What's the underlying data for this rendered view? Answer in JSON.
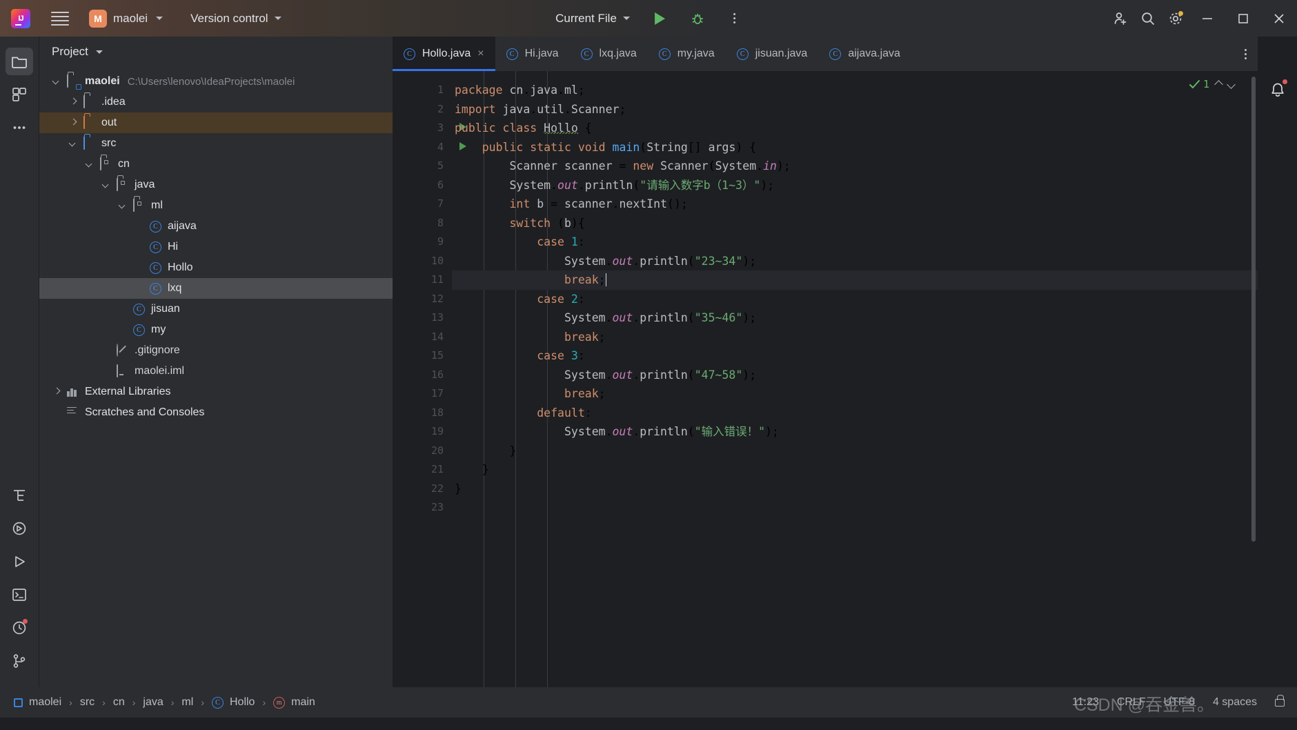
{
  "titlebar": {
    "project_name": "maolei",
    "version_control": "Version control",
    "run_config": "Current File",
    "icons": {
      "logo": "intellij-idea-logo",
      "menu": "hamburger-menu-icon",
      "run": "run-icon",
      "debug": "debug-bug-icon",
      "more": "more-vertical-icon",
      "share": "add-user-icon",
      "search": "search-icon",
      "settings": "gear-icon",
      "minimize": "minimize-icon",
      "maximize": "maximize-icon",
      "close": "close-icon"
    }
  },
  "rail": {
    "items": [
      {
        "name": "project-tool-window",
        "icon": "folder-icon",
        "active": true
      },
      {
        "name": "commit-tool-window",
        "icon": "commit-grid-icon",
        "active": false
      },
      {
        "name": "more-tool-windows",
        "icon": "more-horizontal-icon",
        "active": false
      },
      {
        "name": "structure-tool-window",
        "icon": "structure-icon",
        "active": false
      },
      {
        "name": "services-tool-window",
        "icon": "services-icon",
        "active": false
      },
      {
        "name": "run-tool-window",
        "icon": "run-triangle-icon",
        "active": false
      },
      {
        "name": "terminal-tool-window",
        "icon": "terminal-icon",
        "active": false
      },
      {
        "name": "problems-tool-window",
        "icon": "problems-clock-icon",
        "active": false
      },
      {
        "name": "version-control-tool-window",
        "icon": "branch-icon",
        "active": false
      }
    ]
  },
  "project_panel": {
    "title": "Project",
    "tree": [
      {
        "label": "maolei",
        "secondary": "C:\\Users\\lenovo\\IdeaProjects\\maolei",
        "indent": 0,
        "arrow": "down",
        "icon": "project-folder-icon",
        "state": "normal"
      },
      {
        "label": ".idea",
        "secondary": "",
        "indent": 1,
        "arrow": "right",
        "icon": "folder-icon",
        "state": "normal"
      },
      {
        "label": "out",
        "secondary": "",
        "indent": 1,
        "arrow": "right",
        "icon": "folder-orange-icon",
        "state": "highlight"
      },
      {
        "label": "src",
        "secondary": "",
        "indent": 1,
        "arrow": "down",
        "icon": "source-folder-icon",
        "state": "normal"
      },
      {
        "label": "cn",
        "secondary": "",
        "indent": 2,
        "arrow": "down",
        "icon": "package-icon",
        "state": "normal"
      },
      {
        "label": "java",
        "secondary": "",
        "indent": 3,
        "arrow": "down",
        "icon": "package-icon",
        "state": "normal"
      },
      {
        "label": "ml",
        "secondary": "",
        "indent": 4,
        "arrow": "down",
        "icon": "package-icon",
        "state": "normal"
      },
      {
        "label": "aijava",
        "secondary": "",
        "indent": 5,
        "arrow": "none",
        "icon": "java-class-icon",
        "state": "normal"
      },
      {
        "label": "Hi",
        "secondary": "",
        "indent": 5,
        "arrow": "none",
        "icon": "java-class-icon",
        "state": "normal"
      },
      {
        "label": "Hollo",
        "secondary": "",
        "indent": 5,
        "arrow": "none",
        "icon": "java-class-icon",
        "state": "normal"
      },
      {
        "label": "lxq",
        "secondary": "",
        "indent": 5,
        "arrow": "none",
        "icon": "java-class-icon",
        "state": "selected"
      },
      {
        "label": "jisuan",
        "secondary": "",
        "indent": 4,
        "arrow": "none",
        "icon": "java-class-icon",
        "state": "normal"
      },
      {
        "label": "my",
        "secondary": "",
        "indent": 4,
        "arrow": "none",
        "icon": "java-class-icon",
        "state": "normal"
      },
      {
        "label": ".gitignore",
        "secondary": "",
        "indent": 3,
        "arrow": "none",
        "icon": "gitignore-icon",
        "state": "normal"
      },
      {
        "label": "maolei.iml",
        "secondary": "",
        "indent": 3,
        "arrow": "none",
        "icon": "iml-file-icon",
        "state": "normal"
      },
      {
        "label": "External Libraries",
        "secondary": "",
        "indent": 0,
        "arrow": "right",
        "icon": "libraries-icon",
        "state": "normal"
      },
      {
        "label": "Scratches and Consoles",
        "secondary": "",
        "indent": 0,
        "arrow": "none",
        "icon": "scratches-icon",
        "state": "normal"
      }
    ]
  },
  "tabs": [
    {
      "label": "Hollo.java",
      "active": true,
      "closable": true
    },
    {
      "label": "Hi.java",
      "active": false,
      "closable": false
    },
    {
      "label": "lxq.java",
      "active": false,
      "closable": false
    },
    {
      "label": "my.java",
      "active": false,
      "closable": false
    },
    {
      "label": "jisuan.java",
      "active": false,
      "closable": false
    },
    {
      "label": "aijava.java",
      "active": false,
      "closable": false
    }
  ],
  "editor": {
    "inspection_count": "1",
    "file": "Hollo.java",
    "cursor_line": 11,
    "lines": [
      {
        "n": "1",
        "run": false,
        "text": "package cn.java.ml;"
      },
      {
        "n": "2",
        "run": false,
        "text": "import java.util.Scanner;"
      },
      {
        "n": "3",
        "run": true,
        "text": "public class Hollo {"
      },
      {
        "n": "4",
        "run": true,
        "text": "    public static void main(String[] args) {"
      },
      {
        "n": "5",
        "run": false,
        "text": "        Scanner scanner = new Scanner(System.in);"
      },
      {
        "n": "6",
        "run": false,
        "text": "        System.out.println(\"请输入数字b（1~3）\");"
      },
      {
        "n": "7",
        "run": false,
        "text": "        int b = scanner.nextInt();"
      },
      {
        "n": "8",
        "run": false,
        "text": "        switch (b){"
      },
      {
        "n": "9",
        "run": false,
        "text": "            case 1:"
      },
      {
        "n": "10",
        "run": false,
        "text": "                System.out.println(\"23~34\");"
      },
      {
        "n": "11",
        "run": false,
        "text": "                break;"
      },
      {
        "n": "12",
        "run": false,
        "text": "            case 2:"
      },
      {
        "n": "13",
        "run": false,
        "text": "                System.out.println(\"35~46\");"
      },
      {
        "n": "14",
        "run": false,
        "text": "                break;"
      },
      {
        "n": "15",
        "run": false,
        "text": "            case 3:"
      },
      {
        "n": "16",
        "run": false,
        "text": "                System.out.println(\"47~58\");"
      },
      {
        "n": "17",
        "run": false,
        "text": "                break;"
      },
      {
        "n": "18",
        "run": false,
        "text": "            default:"
      },
      {
        "n": "19",
        "run": false,
        "text": "                System.out.println(\"输入错误！\");"
      },
      {
        "n": "20",
        "run": false,
        "text": "        }"
      },
      {
        "n": "21",
        "run": false,
        "text": "    }"
      },
      {
        "n": "22",
        "run": false,
        "text": "}"
      },
      {
        "n": "23",
        "run": false,
        "text": ""
      }
    ]
  },
  "status": {
    "breadcrumb": [
      "maolei",
      "src",
      "cn",
      "java",
      "ml",
      "Hollo",
      "main"
    ],
    "separator": "›",
    "caret_position": "11:23",
    "line_separator": "CRLF",
    "encoding": "UTF-8",
    "indent": "4 spaces",
    "watermark": "CSDN @吞金兽。"
  },
  "colors": {
    "accent_blue": "#3574f0",
    "keyword": "#cf8e6d",
    "string": "#6aab73",
    "number": "#2aacb8",
    "static_field": "#c77dbb",
    "method": "#56a8f5",
    "bg_editor": "#1e1f22",
    "bg_panel": "#2b2d30",
    "selection": "#4b4d51",
    "highlight_row": "#4a3b26"
  }
}
